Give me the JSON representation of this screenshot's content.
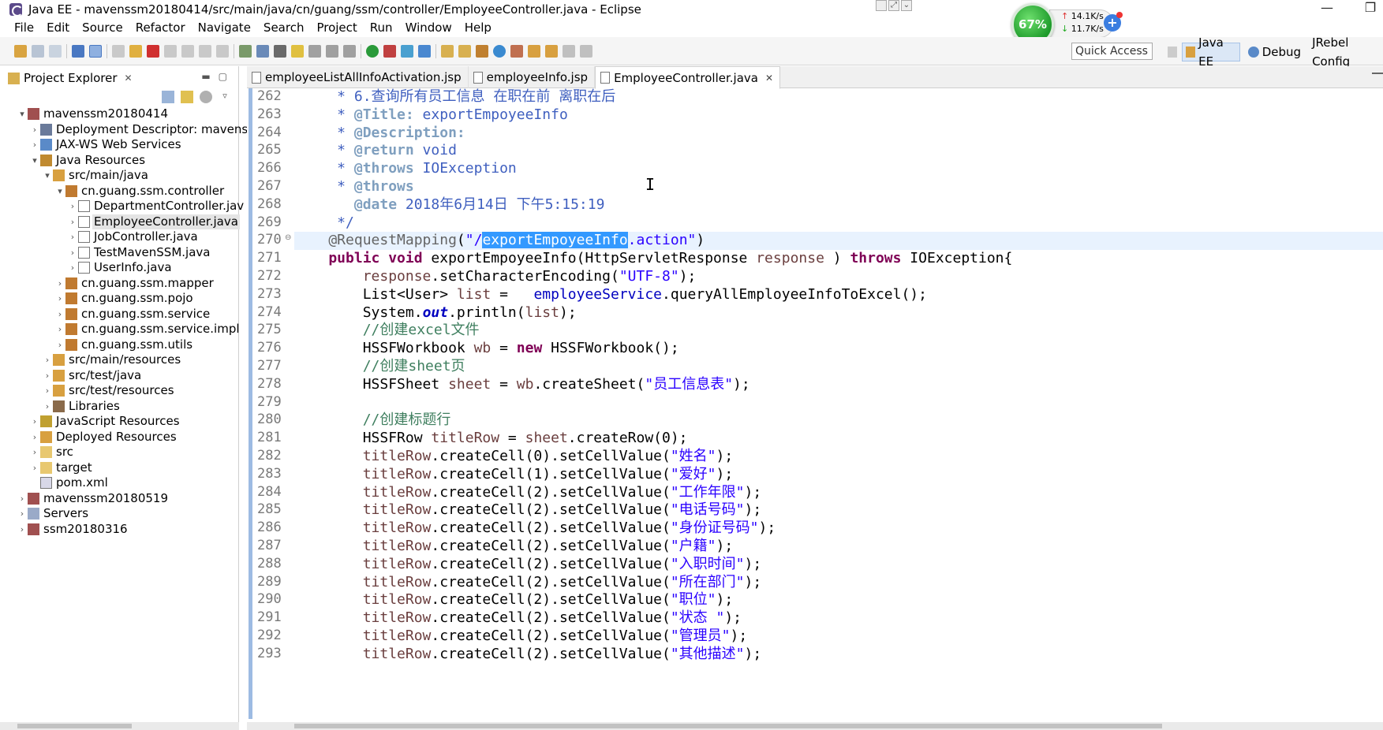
{
  "window": {
    "title": "Java EE - mavenssm20180414/src/main/java/cn/guang/ssm/controller/EmployeeController.java - Eclipse",
    "minimize": "—",
    "maximize": "❐"
  },
  "menu": [
    "File",
    "Edit",
    "Source",
    "Refactor",
    "Navigate",
    "Search",
    "Project",
    "Run",
    "Window",
    "Help"
  ],
  "network": {
    "percent": "67%",
    "upload": "14.1K/s",
    "download": "11.7K/s",
    "add": "+"
  },
  "toolbar": {
    "quick_access": "Quick Access",
    "perspectives": [
      {
        "label": "Java EE",
        "active": true
      },
      {
        "label": "Debug",
        "active": false
      },
      {
        "label": "JRebel Config",
        "active": false
      }
    ]
  },
  "explorer": {
    "title": "Project Explorer",
    "close": "✕",
    "tree": [
      {
        "label": "mavenssm20180414",
        "depth": 0,
        "twisty": "▾",
        "icon": "project-icon"
      },
      {
        "label": "Deployment Descriptor: mavenss",
        "depth": 1,
        "twisty": "›",
        "icon": "descriptor-icon"
      },
      {
        "label": "JAX-WS Web Services",
        "depth": 1,
        "twisty": "›",
        "icon": "webservice-icon"
      },
      {
        "label": "Java Resources",
        "depth": 1,
        "twisty": "▾",
        "icon": "java-resources-icon"
      },
      {
        "label": "src/main/java",
        "depth": 2,
        "twisty": "▾",
        "icon": "source-folder-icon"
      },
      {
        "label": "cn.guang.ssm.controller",
        "depth": 3,
        "twisty": "▾",
        "icon": "package-icon"
      },
      {
        "label": "DepartmentController.jav",
        "depth": 4,
        "twisty": "›",
        "icon": "java-file-icon"
      },
      {
        "label": "EmployeeController.java",
        "depth": 4,
        "twisty": "›",
        "icon": "java-file-icon",
        "selected": true
      },
      {
        "label": "JobController.java",
        "depth": 4,
        "twisty": "›",
        "icon": "java-file-icon"
      },
      {
        "label": "TestMavenSSM.java",
        "depth": 4,
        "twisty": "›",
        "icon": "java-file-icon"
      },
      {
        "label": "UserInfo.java",
        "depth": 4,
        "twisty": "›",
        "icon": "java-file-icon"
      },
      {
        "label": "cn.guang.ssm.mapper",
        "depth": 3,
        "twisty": "›",
        "icon": "package-icon"
      },
      {
        "label": "cn.guang.ssm.pojo",
        "depth": 3,
        "twisty": "›",
        "icon": "package-icon"
      },
      {
        "label": "cn.guang.ssm.service",
        "depth": 3,
        "twisty": "›",
        "icon": "package-icon"
      },
      {
        "label": "cn.guang.ssm.service.impl",
        "depth": 3,
        "twisty": "›",
        "icon": "package-icon"
      },
      {
        "label": "cn.guang.ssm.utils",
        "depth": 3,
        "twisty": "›",
        "icon": "package-icon"
      },
      {
        "label": "src/main/resources",
        "depth": 2,
        "twisty": "›",
        "icon": "source-folder-icon"
      },
      {
        "label": "src/test/java",
        "depth": 2,
        "twisty": "›",
        "icon": "source-folder-icon"
      },
      {
        "label": "src/test/resources",
        "depth": 2,
        "twisty": "›",
        "icon": "source-folder-icon"
      },
      {
        "label": "Libraries",
        "depth": 2,
        "twisty": "›",
        "icon": "library-icon"
      },
      {
        "label": "JavaScript Resources",
        "depth": 1,
        "twisty": "›",
        "icon": "js-resources-icon"
      },
      {
        "label": "Deployed Resources",
        "depth": 1,
        "twisty": "›",
        "icon": "deployed-icon"
      },
      {
        "label": "src",
        "depth": 1,
        "twisty": "›",
        "icon": "folder-icon"
      },
      {
        "label": "target",
        "depth": 1,
        "twisty": "›",
        "icon": "folder-icon"
      },
      {
        "label": "pom.xml",
        "depth": 1,
        "twisty": "",
        "icon": "xml-file-icon"
      },
      {
        "label": "mavenssm20180519",
        "depth": 0,
        "twisty": "›",
        "icon": "project-icon"
      },
      {
        "label": "Servers",
        "depth": 0,
        "twisty": "›",
        "icon": "servers-icon"
      },
      {
        "label": "ssm20180316",
        "depth": 0,
        "twisty": "›",
        "icon": "project-icon"
      }
    ]
  },
  "editor": {
    "tabs": [
      {
        "label": "employeeListAllInfoActivation.jsp",
        "active": false
      },
      {
        "label": "employeeInfo.jsp",
        "active": false
      },
      {
        "label": "EmployeeController.java",
        "active": true,
        "close": "✕"
      }
    ],
    "lines": [
      {
        "no": "262",
        "segs": [
          [
            "jd",
            "     * 6.查询所有员工信息 在职在前 离职在后"
          ]
        ]
      },
      {
        "no": "263",
        "segs": [
          [
            "jd",
            "     * "
          ],
          [
            "jdtag",
            "@Title:"
          ],
          [
            "jd",
            " exportEmpoyeeInfo"
          ]
        ]
      },
      {
        "no": "264",
        "segs": [
          [
            "jd",
            "     * "
          ],
          [
            "jdtag",
            "@Description:"
          ]
        ]
      },
      {
        "no": "265",
        "segs": [
          [
            "jd",
            "     * "
          ],
          [
            "jdtag",
            "@return"
          ],
          [
            "jd",
            " void"
          ]
        ]
      },
      {
        "no": "266",
        "segs": [
          [
            "jd",
            "     * "
          ],
          [
            "jdtag",
            "@throws"
          ],
          [
            "jd",
            " IOException"
          ]
        ]
      },
      {
        "no": "267",
        "segs": [
          [
            "jd",
            "     * "
          ],
          [
            "jdtag",
            "@throws"
          ]
        ]
      },
      {
        "no": "268",
        "segs": [
          [
            "jd",
            "       "
          ],
          [
            "jdtag",
            "@date"
          ],
          [
            "jd",
            " 2018年6月14日 下午5:15:19"
          ]
        ]
      },
      {
        "no": "269",
        "segs": [
          [
            "jd",
            "     */"
          ]
        ]
      },
      {
        "no": "270",
        "fold": true,
        "current": true,
        "segs": [
          [
            "ann",
            "    @RequestMapping"
          ],
          [
            "",
            "("
          ],
          [
            "str",
            "\"/"
          ],
          [
            "sel",
            "exportEmpoyeeInfo"
          ],
          [
            "str",
            ".action\""
          ],
          [
            "",
            ")"
          ]
        ]
      },
      {
        "no": "271",
        "segs": [
          [
            "kw",
            "    public"
          ],
          [
            "",
            " "
          ],
          [
            "kw",
            "void"
          ],
          [
            "",
            " exportEmpoyeeInfo(HttpServletResponse "
          ],
          [
            "lv",
            "response"
          ],
          [
            "",
            " ) "
          ],
          [
            "kw",
            "throws"
          ],
          [
            "",
            " IOException{"
          ]
        ]
      },
      {
        "no": "272",
        "segs": [
          [
            "",
            "        "
          ],
          [
            "lv",
            "response"
          ],
          [
            "",
            ".setCharacterEncoding("
          ],
          [
            "str",
            "\"UTF-8\""
          ],
          [
            "",
            ");"
          ]
        ]
      },
      {
        "no": "273",
        "segs": [
          [
            "",
            "        List<User> "
          ],
          [
            "lv",
            "list"
          ],
          [
            "",
            " =   "
          ],
          [
            "fld",
            "employeeService"
          ],
          [
            "",
            ".queryAllEmployeeInfoToExcel();"
          ]
        ]
      },
      {
        "no": "274",
        "segs": [
          [
            "",
            "        System."
          ],
          [
            "sfld",
            "out"
          ],
          [
            "",
            ".println("
          ],
          [
            "lv",
            "list"
          ],
          [
            "",
            ");"
          ]
        ]
      },
      {
        "no": "275",
        "segs": [
          [
            "cm",
            "        //创建excel文件"
          ]
        ]
      },
      {
        "no": "276",
        "segs": [
          [
            "",
            "        HSSFWorkbook "
          ],
          [
            "lv",
            "wb"
          ],
          [
            "",
            " = "
          ],
          [
            "kw",
            "new"
          ],
          [
            "",
            " HSSFWorkbook();"
          ]
        ]
      },
      {
        "no": "277",
        "segs": [
          [
            "cm",
            "        //创建sheet页"
          ]
        ]
      },
      {
        "no": "278",
        "segs": [
          [
            "",
            "        HSSFSheet "
          ],
          [
            "lv",
            "sheet"
          ],
          [
            "",
            " = "
          ],
          [
            "lv",
            "wb"
          ],
          [
            "",
            ".createSheet("
          ],
          [
            "str",
            "\"员工信息表\""
          ],
          [
            "",
            ");"
          ]
        ]
      },
      {
        "no": "279",
        "segs": [
          [
            "",
            ""
          ]
        ]
      },
      {
        "no": "280",
        "segs": [
          [
            "cm",
            "        //创建标题行"
          ]
        ]
      },
      {
        "no": "281",
        "segs": [
          [
            "",
            "        HSSFRow "
          ],
          [
            "lv",
            "titleRow"
          ],
          [
            "",
            " = "
          ],
          [
            "lv",
            "sheet"
          ],
          [
            "",
            ".createRow(0);"
          ]
        ]
      },
      {
        "no": "282",
        "segs": [
          [
            "lv",
            "        titleRow"
          ],
          [
            "",
            ".createCell(0).setCellValue("
          ],
          [
            "str",
            "\"姓名\""
          ],
          [
            "",
            ");"
          ]
        ]
      },
      {
        "no": "283",
        "segs": [
          [
            "lv",
            "        titleRow"
          ],
          [
            "",
            ".createCell(1).setCellValue("
          ],
          [
            "str",
            "\"爱好\""
          ],
          [
            "",
            ");"
          ]
        ]
      },
      {
        "no": "284",
        "segs": [
          [
            "lv",
            "        titleRow"
          ],
          [
            "",
            ".createCell(2).setCellValue("
          ],
          [
            "str",
            "\"工作年限\""
          ],
          [
            "",
            ");"
          ]
        ]
      },
      {
        "no": "285",
        "segs": [
          [
            "lv",
            "        titleRow"
          ],
          [
            "",
            ".createCell(2).setCellValue("
          ],
          [
            "str",
            "\"电话号码\""
          ],
          [
            "",
            ");"
          ]
        ]
      },
      {
        "no": "286",
        "segs": [
          [
            "lv",
            "        titleRow"
          ],
          [
            "",
            ".createCell(2).setCellValue("
          ],
          [
            "str",
            "\"身份证号码\""
          ],
          [
            "",
            ");"
          ]
        ]
      },
      {
        "no": "287",
        "segs": [
          [
            "lv",
            "        titleRow"
          ],
          [
            "",
            ".createCell(2).setCellValue("
          ],
          [
            "str",
            "\"户籍\""
          ],
          [
            "",
            ");"
          ]
        ]
      },
      {
        "no": "288",
        "segs": [
          [
            "lv",
            "        titleRow"
          ],
          [
            "",
            ".createCell(2).setCellValue("
          ],
          [
            "str",
            "\"入职时间\""
          ],
          [
            "",
            ");"
          ]
        ]
      },
      {
        "no": "289",
        "segs": [
          [
            "lv",
            "        titleRow"
          ],
          [
            "",
            ".createCell(2).setCellValue("
          ],
          [
            "str",
            "\"所在部门\""
          ],
          [
            "",
            ");"
          ]
        ]
      },
      {
        "no": "290",
        "segs": [
          [
            "lv",
            "        titleRow"
          ],
          [
            "",
            ".createCell(2).setCellValue("
          ],
          [
            "str",
            "\"职位\""
          ],
          [
            "",
            ");"
          ]
        ]
      },
      {
        "no": "291",
        "segs": [
          [
            "lv",
            "        titleRow"
          ],
          [
            "",
            ".createCell(2).setCellValue("
          ],
          [
            "str",
            "\"状态 \""
          ],
          [
            "",
            ");"
          ]
        ]
      },
      {
        "no": "292",
        "segs": [
          [
            "lv",
            "        titleRow"
          ],
          [
            "",
            ".createCell(2).setCellValue("
          ],
          [
            "str",
            "\"管理员\""
          ],
          [
            "",
            ");"
          ]
        ]
      },
      {
        "no": "293",
        "segs": [
          [
            "lv",
            "        titleRow"
          ],
          [
            "",
            ".createCell(2).setCellValue("
          ],
          [
            "str",
            "\"其他描述\""
          ],
          [
            "",
            ");"
          ]
        ]
      }
    ]
  }
}
